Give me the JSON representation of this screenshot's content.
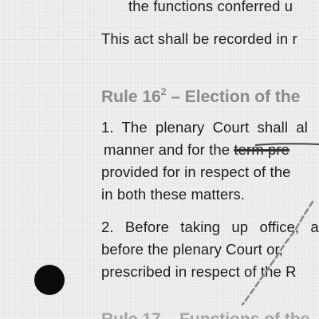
{
  "document": {
    "fragment_top": "the functions conferred u",
    "paragraph_record": "This act shall be recorded in r",
    "rule16": {
      "heading_number": "Rule 16",
      "heading_sup": "2",
      "heading_rest": " – Election of the",
      "p1_lines": [
        "1. The plenary Court shall al",
        "manner and for the ",
        "provided for in respect of the",
        "in both these matters."
      ],
      "p1_struck": "term pre",
      "p2_lines": [
        "2. Before taking up office, a",
        "before the plenary Court or,",
        "prescribed in respect of the R"
      ]
    },
    "rule17_heading_partial": "Rule 17 – Functions of the"
  }
}
